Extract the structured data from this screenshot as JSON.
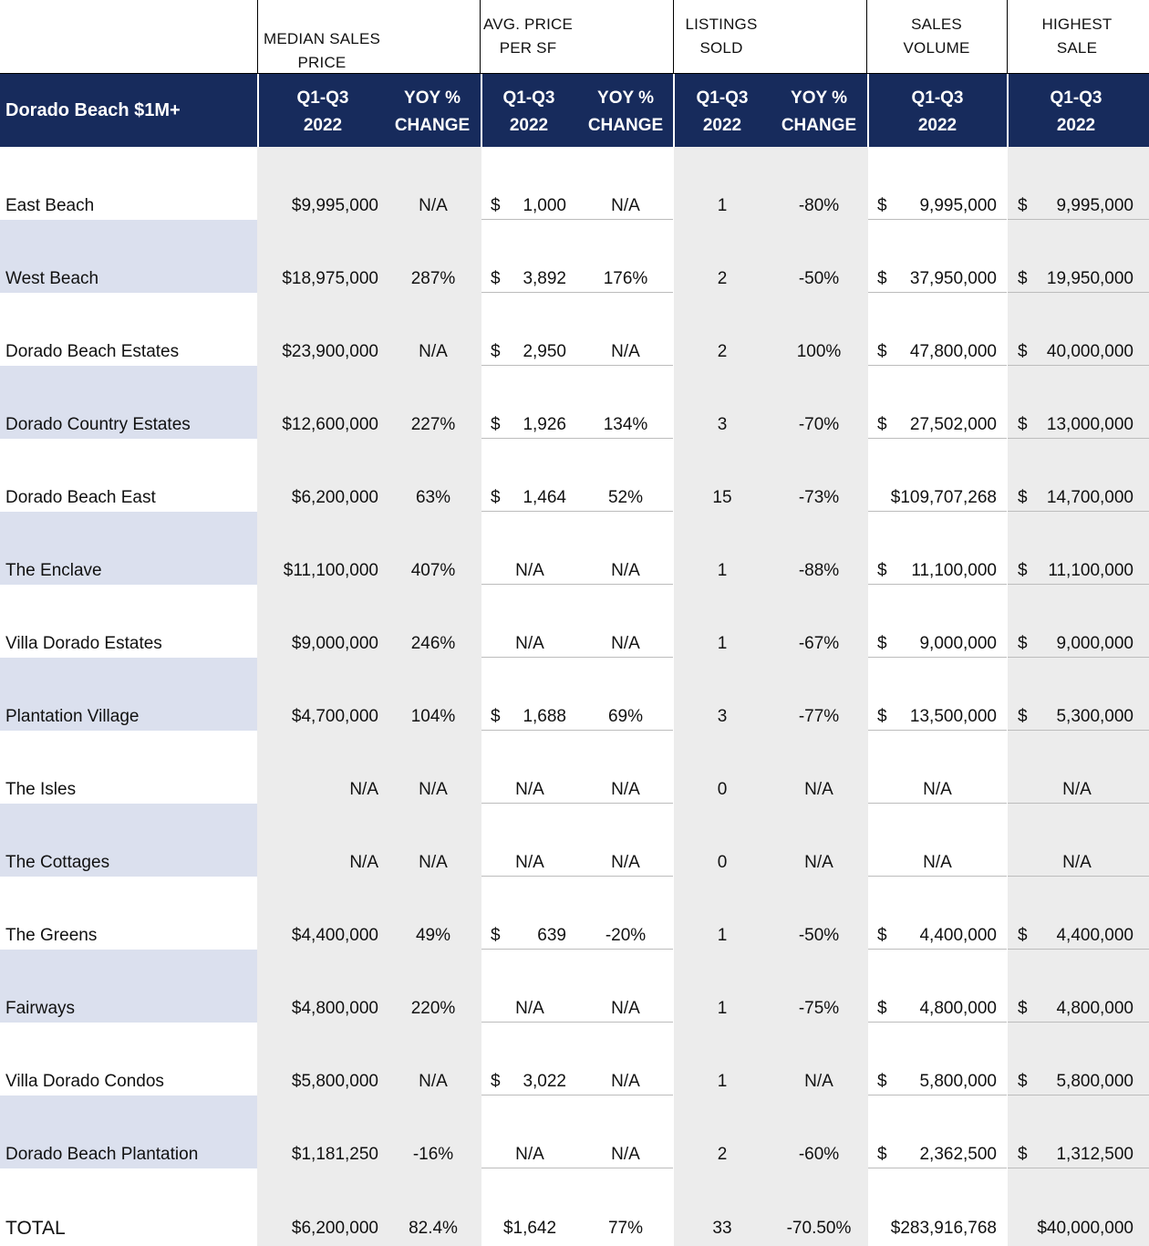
{
  "top_header": {
    "median_sales_price": [
      "MEDIAN SALES",
      "PRICE"
    ],
    "avg_price_per_sf": [
      "AVG. PRICE",
      "PER SF"
    ],
    "listings_sold": [
      "LISTINGS",
      "SOLD"
    ],
    "sales_volume": [
      "SALES",
      "VOLUME"
    ],
    "highest_sale": [
      "HIGHEST",
      "SALE"
    ]
  },
  "band": {
    "title": "Dorado Beach $1M+",
    "period": [
      "Q1-Q3",
      "2022"
    ],
    "yoy": [
      "YOY %",
      "CHANGE"
    ]
  },
  "currency_symbol": "$",
  "rows": [
    {
      "name": "East Beach",
      "median": "$9,995,000",
      "median_yoy": "N/A",
      "ppsf": "1,000",
      "ppsf_yoy": "N/A",
      "listings": "1",
      "listings_yoy": "-80%",
      "volume": "9,995,000",
      "highest": "9,995,000"
    },
    {
      "name": "West Beach",
      "median": "$18,975,000",
      "median_yoy": "287%",
      "ppsf": "3,892",
      "ppsf_yoy": "176%",
      "listings": "2",
      "listings_yoy": "-50%",
      "volume": "37,950,000",
      "highest": "19,950,000"
    },
    {
      "name": "Dorado Beach Estates",
      "median": "$23,900,000",
      "median_yoy": "N/A",
      "ppsf": "2,950",
      "ppsf_yoy": "N/A",
      "listings": "2",
      "listings_yoy": "100%",
      "volume": "47,800,000",
      "highest": "40,000,000"
    },
    {
      "name": "Dorado Country Estates",
      "median": "$12,600,000",
      "median_yoy": "227%",
      "ppsf": "1,926",
      "ppsf_yoy": "134%",
      "listings": "3",
      "listings_yoy": "-70%",
      "volume": "27,502,000",
      "highest": "13,000,000"
    },
    {
      "name": "Dorado Beach East",
      "median": "$6,200,000",
      "median_yoy": "63%",
      "ppsf": "1,464",
      "ppsf_yoy": "52%",
      "listings": "15",
      "listings_yoy": "-73%",
      "volume": "$109,707,268",
      "highest": "14,700,000"
    },
    {
      "name": "The Enclave",
      "median": "$11,100,000",
      "median_yoy": "407%",
      "ppsf": "N/A",
      "ppsf_yoy": "N/A",
      "listings": "1",
      "listings_yoy": "-88%",
      "volume": "11,100,000",
      "highest": "11,100,000"
    },
    {
      "name": "Villa Dorado Estates",
      "median": "$9,000,000",
      "median_yoy": "246%",
      "ppsf": "N/A",
      "ppsf_yoy": "N/A",
      "listings": "1",
      "listings_yoy": "-67%",
      "volume": "9,000,000",
      "highest": "9,000,000"
    },
    {
      "name": "Plantation Village",
      "median": "$4,700,000",
      "median_yoy": "104%",
      "ppsf": "1,688",
      "ppsf_yoy": "69%",
      "listings": "3",
      "listings_yoy": "-77%",
      "volume": "13,500,000",
      "highest": "5,300,000"
    },
    {
      "name": "The Isles",
      "median": "N/A",
      "median_yoy": "N/A",
      "ppsf": "N/A",
      "ppsf_yoy": "N/A",
      "listings": "0",
      "listings_yoy": "N/A",
      "volume": "N/A",
      "highest": "N/A"
    },
    {
      "name": "The Cottages",
      "median": "N/A",
      "median_yoy": "N/A",
      "ppsf": "N/A",
      "ppsf_yoy": "N/A",
      "listings": "0",
      "listings_yoy": "N/A",
      "volume": "N/A",
      "highest": "N/A"
    },
    {
      "name": "The Greens",
      "median": "$4,400,000",
      "median_yoy": "49%",
      "ppsf": "639",
      "ppsf_yoy": "-20%",
      "listings": "1",
      "listings_yoy": "-50%",
      "volume": "4,400,000",
      "highest": "4,400,000"
    },
    {
      "name": "Fairways",
      "median": "$4,800,000",
      "median_yoy": "220%",
      "ppsf": "N/A",
      "ppsf_yoy": "N/A",
      "listings": "1",
      "listings_yoy": "-75%",
      "volume": "4,800,000",
      "highest": "4,800,000"
    },
    {
      "name": "Villa Dorado Condos",
      "median": "$5,800,000",
      "median_yoy": "N/A",
      "ppsf": "3,022",
      "ppsf_yoy": "N/A",
      "listings": "1",
      "listings_yoy": "N/A",
      "volume": "5,800,000",
      "highest": "5,800,000"
    },
    {
      "name": "Dorado Beach Plantation",
      "median": "$1,181,250",
      "median_yoy": "-16%",
      "ppsf": "N/A",
      "ppsf_yoy": "N/A",
      "listings": "2",
      "listings_yoy": "-60%",
      "volume": "2,362,500",
      "highest": "1,312,500"
    }
  ],
  "total": {
    "name": "TOTAL",
    "median": "$6,200,000",
    "median_yoy": "82.4%",
    "ppsf": "$1,642",
    "ppsf_yoy": "77%",
    "listings": "33",
    "listings_yoy": "-70.50%",
    "volume": "$283,916,768",
    "highest": "$40,000,000"
  }
}
